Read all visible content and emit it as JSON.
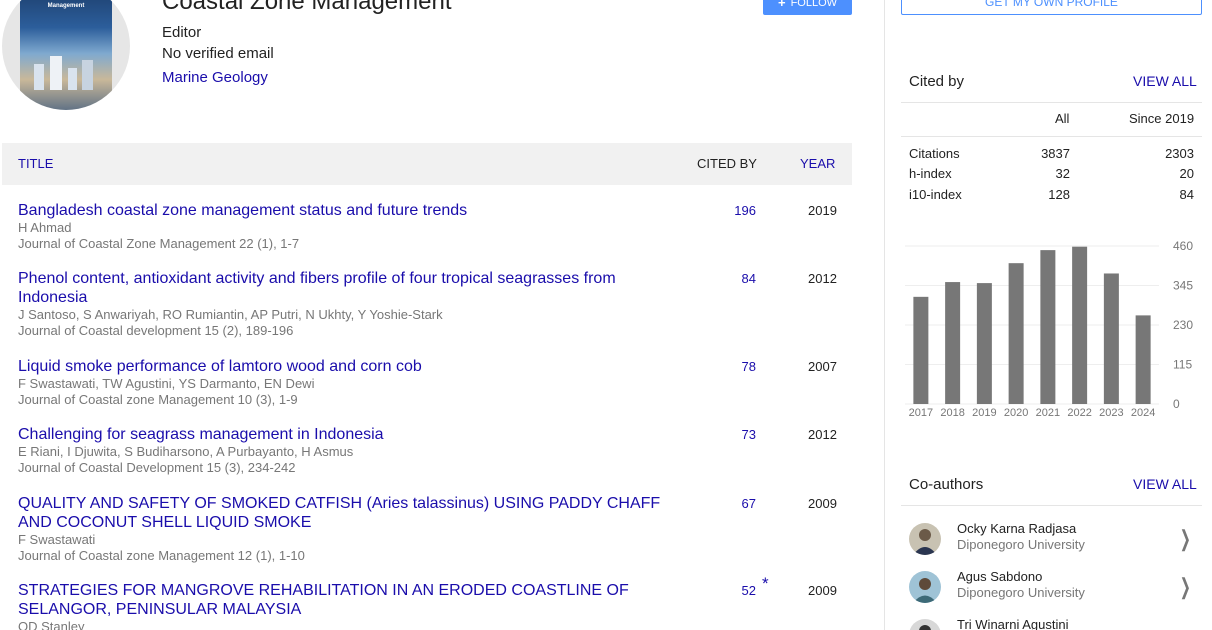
{
  "profile": {
    "name": "Coastal Zone Management",
    "affiliation": "Editor",
    "email": "No verified email",
    "interest": "Marine Geology",
    "cover_text": "Journal of Coastal Zone Management",
    "follow_label": "FOLLOW"
  },
  "table": {
    "col_title": "TITLE",
    "col_cited": "CITED BY",
    "col_year": "YEAR",
    "rows": [
      {
        "title": "Bangladesh coastal zone management status and future trends",
        "authors": "H Ahmad",
        "venue": "Journal of Coastal Zone Management 22 (1), 1-7",
        "cited": "196",
        "year": "2019",
        "star": ""
      },
      {
        "title": "Phenol content, antioxidant activity and fibers profile of four tropical seagrasses from Indonesia",
        "authors": "J Santoso, S Anwariyah, RO Rumiantin, AP Putri, N Ukhty, Y Yoshie-Stark",
        "venue": "Journal of Coastal development 15 (2), 189-196",
        "cited": "84",
        "year": "2012",
        "star": ""
      },
      {
        "title": "Liquid smoke performance of lamtoro wood and corn cob",
        "authors": "F Swastawati, TW Agustini, YS Darmanto, EN Dewi",
        "venue": "Journal of Coastal zone Management 10 (3), 1-9",
        "cited": "78",
        "year": "2007",
        "star": ""
      },
      {
        "title": "Challenging for seagrass management in Indonesia",
        "authors": "E Riani, I Djuwita, S Budiharsono, A Purbayanto, H Asmus",
        "venue": "Journal of Coastal Development 15 (3), 234-242",
        "cited": "73",
        "year": "2012",
        "star": ""
      },
      {
        "title": "QUALITY AND SAFETY OF SMOKED CATFISH (Aries talassinus) USING PADDY CHAFF AND COCONUT SHELL LIQUID SMOKE",
        "authors": "F Swastawati",
        "venue": "Journal of Coastal zone Management 12 (1), 1-10",
        "cited": "67",
        "year": "2009",
        "star": ""
      },
      {
        "title": "STRATEGIES FOR MANGROVE REHABILITATION IN AN ERODED COASTLINE OF SELANGOR, PENINSULAR MALAYSIA",
        "authors": "OD Stanley",
        "venue": "",
        "cited": "52",
        "year": "2009",
        "star": "*"
      }
    ]
  },
  "sidebar": {
    "own_profile_label": "GET MY OWN PROFILE",
    "cited_by": {
      "title": "Cited by",
      "view_all": "VIEW ALL",
      "col_all": "All",
      "col_since": "Since 2019",
      "metrics": [
        {
          "label": "Citations",
          "all": "3837",
          "since": "2303"
        },
        {
          "label": "h-index",
          "all": "32",
          "since": "20"
        },
        {
          "label": "i10-index",
          "all": "128",
          "since": "84"
        }
      ]
    },
    "coauthors": {
      "title": "Co-authors",
      "view_all": "VIEW ALL",
      "items": [
        {
          "name": "Ocky Karna Radjasa",
          "institution": "Diponegoro University"
        },
        {
          "name": "Agus Sabdono",
          "institution": "Diponegoro University"
        },
        {
          "name": "Tri Winarni Agustini",
          "institution": ""
        }
      ]
    }
  },
  "chart_data": {
    "type": "bar",
    "categories": [
      "2017",
      "2018",
      "2019",
      "2020",
      "2021",
      "2022",
      "2023",
      "2024"
    ],
    "values": [
      312,
      355,
      352,
      410,
      448,
      458,
      380,
      258
    ],
    "yticks": [
      "460",
      "345",
      "230",
      "115",
      "0"
    ],
    "ylim": [
      0,
      460
    ],
    "bar_color": "#777777",
    "grid": true
  },
  "colors": {
    "link": "#1a0dab",
    "accent": "#4d90fe",
    "muted": "#777777"
  }
}
